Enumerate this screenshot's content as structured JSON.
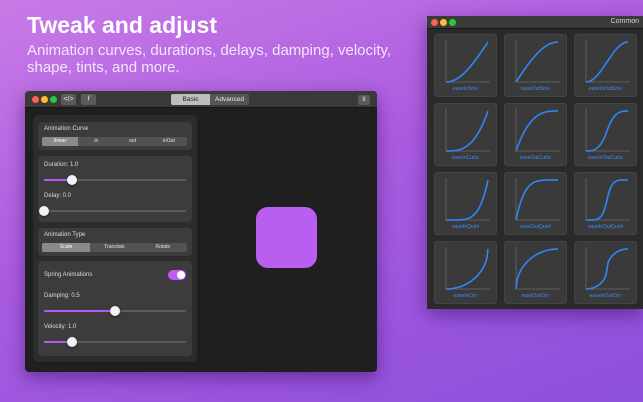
{
  "hero": {
    "title": "Tweak and adjust",
    "subtitle": "Animation curves, durations, delays, damping, velocity, shape, tints, and more."
  },
  "main_window": {
    "toolbar": {
      "code_label": "</>",
      "function_label": "f",
      "tabs": [
        {
          "label": "Basic",
          "selected": true
        },
        {
          "label": "Advanced",
          "selected": false
        }
      ],
      "pause_label": "II"
    },
    "animation_curve": {
      "label": "Animation Curve",
      "options": [
        {
          "label": "linear",
          "selected": true
        },
        {
          "label": "in",
          "selected": false
        },
        {
          "label": "out",
          "selected": false
        },
        {
          "label": "inOut",
          "selected": false
        }
      ]
    },
    "duration": {
      "label": "Duration: 1.0",
      "fraction": 0.2
    },
    "delay": {
      "label": "Delay: 0.0",
      "fraction": 0.0
    },
    "animation_type": {
      "label": "Animation Type",
      "options": [
        {
          "label": "Scale",
          "selected": true
        },
        {
          "label": "Translate",
          "selected": false
        },
        {
          "label": "Rotate",
          "selected": false
        }
      ]
    },
    "spring": {
      "label": "Spring Animations",
      "enabled": true
    },
    "damping": {
      "label": "Damping: 0.5",
      "fraction": 0.5
    },
    "velocity": {
      "label": "Velocity: 1.0",
      "fraction": 0.2
    },
    "preview_color": "#ba5ef2",
    "accent_color": "#b45af0"
  },
  "curves_window": {
    "title": "Common",
    "curve_color": "#2f86f6",
    "curves": [
      {
        "name": "easeInSine"
      },
      {
        "name": "easeOutSine"
      },
      {
        "name": "easeInOutSine"
      },
      {
        "name": "easeInCubic"
      },
      {
        "name": "easeOutCubic"
      },
      {
        "name": "easeInOutCubic"
      },
      {
        "name": "easeInQuint"
      },
      {
        "name": "easeOutQuint"
      },
      {
        "name": "easeInOutQuint"
      },
      {
        "name": "easeInCirc"
      },
      {
        "name": "easeOutCirc"
      },
      {
        "name": "easeInOutCirc"
      }
    ]
  }
}
